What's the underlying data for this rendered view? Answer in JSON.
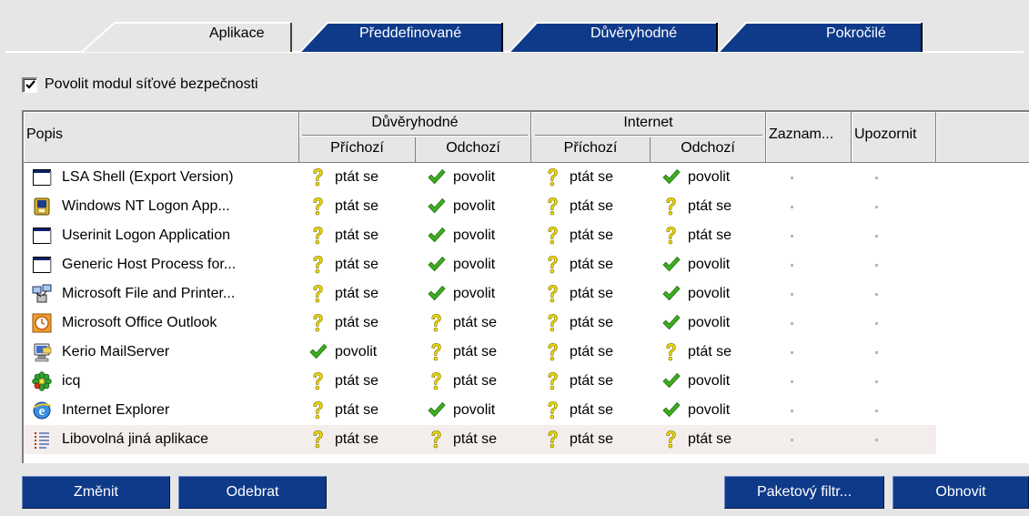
{
  "tabs": [
    {
      "label": "Aplikace",
      "active": true
    },
    {
      "label": "Předdefinované",
      "active": false
    },
    {
      "label": "Důvěryhodné",
      "active": false
    },
    {
      "label": "Pokročilé",
      "active": false
    }
  ],
  "enable_checkbox": {
    "label": "Povolit modul síťové bezpečnosti",
    "checked": true
  },
  "table": {
    "headers": {
      "popis": "Popis",
      "trusted_group": "Důvěryhodné",
      "internet_group": "Internet",
      "incoming": "Příchozí",
      "outgoing": "Odchozí",
      "log": "Zaznam...",
      "notify": "Upozornit"
    },
    "rows": [
      {
        "name": "LSA Shell (Export Version)",
        "icon": "window-icon",
        "t_in": "ptát se",
        "t_out": "povolit",
        "i_in": "ptát se",
        "i_out": "povolit"
      },
      {
        "name": "Windows NT Logon App...",
        "icon": "winlogon-icon",
        "t_in": "ptát se",
        "t_out": "povolit",
        "i_in": "ptát se",
        "i_out": "ptát se"
      },
      {
        "name": "Userinit Logon Application",
        "icon": "window-icon",
        "t_in": "ptát se",
        "t_out": "povolit",
        "i_in": "ptát se",
        "i_out": "ptát se"
      },
      {
        "name": "Generic Host Process for...",
        "icon": "window-icon",
        "t_in": "ptát se",
        "t_out": "povolit",
        "i_in": "ptát se",
        "i_out": "povolit"
      },
      {
        "name": "Microsoft File and Printer...",
        "icon": "network-icon",
        "t_in": "ptát se",
        "t_out": "povolit",
        "i_in": "ptát se",
        "i_out": "povolit"
      },
      {
        "name": "Microsoft Office Outlook",
        "icon": "outlook-icon",
        "t_in": "ptát se",
        "t_out": "ptát se",
        "i_in": "ptát se",
        "i_out": "povolit"
      },
      {
        "name": "Kerio MailServer",
        "icon": "mailserver-icon",
        "t_in": "povolit",
        "t_out": "ptát se",
        "i_in": "ptát se",
        "i_out": "ptát se"
      },
      {
        "name": "icq",
        "icon": "icq-flower-icon",
        "t_in": "ptát se",
        "t_out": "ptát se",
        "i_in": "ptát se",
        "i_out": "povolit"
      },
      {
        "name": "Internet Explorer",
        "icon": "ie-icon",
        "t_in": "ptát se",
        "t_out": "povolit",
        "i_in": "ptát se",
        "i_out": "povolit"
      },
      {
        "name": "Libovolná jiná aplikace",
        "icon": "list-icon",
        "t_in": "ptát se",
        "t_out": "ptát se",
        "i_in": "ptát se",
        "i_out": "ptát se",
        "selected": true
      }
    ]
  },
  "buttons": {
    "change": "Změnit",
    "remove": "Odebrat",
    "packet_filter": "Paketový filtr...",
    "refresh": "Obnovit"
  },
  "colors": {
    "button_bg": "#0f3a8a",
    "tab_inactive": "#0f3a8a",
    "allow_check": "#3fae1f",
    "ask_question": "#f0e000"
  }
}
